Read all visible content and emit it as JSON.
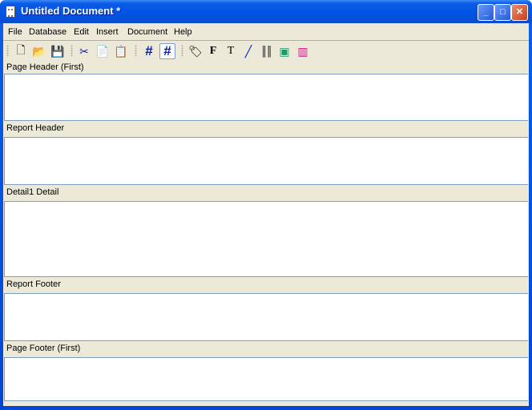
{
  "window": {
    "title": "Untitled Document *",
    "minimize": "_",
    "maximize": "□",
    "close": "✕"
  },
  "menu": [
    "File",
    "Database",
    "Edit",
    "Insert",
    "Document",
    "Help"
  ],
  "toolbar": [
    {
      "name": "new-document-icon",
      "glyph": "🗋"
    },
    {
      "name": "open-folder-icon",
      "glyph": "📂"
    },
    {
      "name": "save-icon",
      "glyph": "💾"
    },
    {
      "name": "cut-icon",
      "glyph": "✂"
    },
    {
      "name": "copy-icon",
      "glyph": "📄"
    },
    {
      "name": "paste-icon",
      "glyph": "📋"
    },
    {
      "name": "grid-icon",
      "glyph": "#"
    },
    {
      "name": "snap-to-grid-icon",
      "glyph": "#",
      "active": true
    },
    {
      "name": "label-tag-icon",
      "glyph": "🏷"
    },
    {
      "name": "field-icon",
      "glyph": "F"
    },
    {
      "name": "text-icon",
      "glyph": "T"
    },
    {
      "name": "line-icon",
      "glyph": "╱"
    },
    {
      "name": "barcode-icon",
      "glyph": "║║"
    },
    {
      "name": "image-icon",
      "glyph": "▣"
    },
    {
      "name": "chart-icon",
      "glyph": "▥"
    }
  ],
  "sections": [
    "Page Header (First)",
    "Report Header",
    "Detail1 Detail",
    "Report Footer",
    "Page Footer (First)"
  ]
}
